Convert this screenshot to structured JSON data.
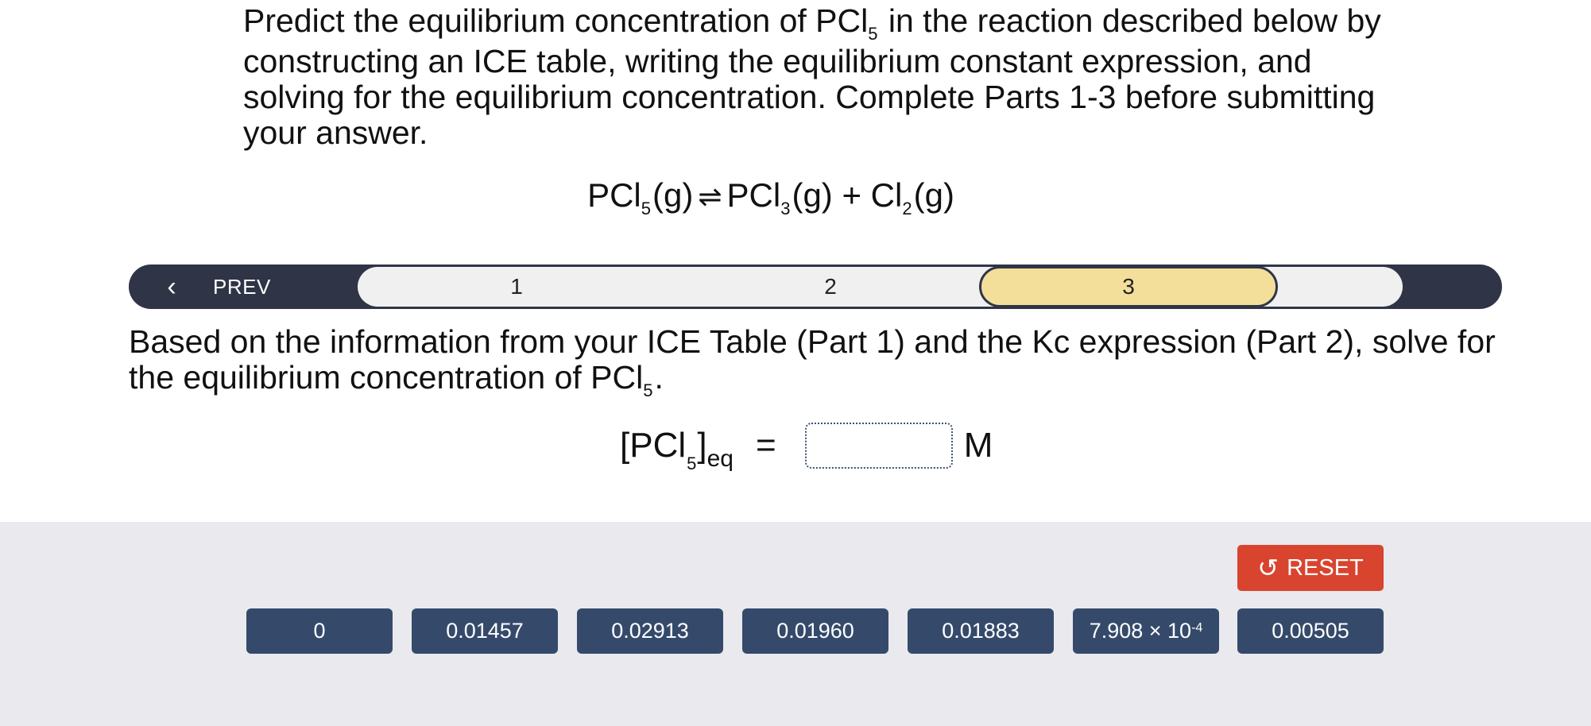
{
  "prompt": {
    "text_before": "Predict the equilibrium concentration of PCl",
    "subscript": "5",
    "text_after": " in the reaction described below by constructing an ICE table, writing the equilibrium constant expression, and solving for the equilibrium concentration. Complete Parts 1-3 before submitting your answer."
  },
  "equation": {
    "reactant": "PCl",
    "reactant_sub": "5",
    "reactant_state": "(g)",
    "arrow": "⇌",
    "product1": "PCl",
    "product1_sub": "3",
    "product1_state": "(g)",
    "plus": "+",
    "product2": "Cl",
    "product2_sub": "2",
    "product2_state": "(g)"
  },
  "nav": {
    "prev_label": "PREV",
    "prev_icon": "chevron-left-icon",
    "parts": [
      "1",
      "2",
      "3"
    ],
    "active_part": "3"
  },
  "question": {
    "text_before": "Based on the information from your ICE Table (Part 1) and the  Kc expression (Part 2), solve for the equilibrium concentration of PCl",
    "subscript": "5",
    "text_after": "."
  },
  "answer": {
    "label_open": "[PCl",
    "label_sub": "5",
    "label_close": "]",
    "label_eq": "eq",
    "equals": "=",
    "value": "",
    "unit": "M"
  },
  "tray": {
    "reset_label": "RESET",
    "reset_icon": "undo-icon",
    "chips": [
      "0",
      "0.01457",
      "0.02913",
      "0.01960",
      "0.01883",
      "7.908 × 10",
      "0.00505"
    ],
    "chip6_exponent": "-4"
  },
  "colors": {
    "nav_dark": "#2f3546",
    "active_part": "#f3df9a",
    "reset": "#d9442f",
    "chip": "#354a6b",
    "tray": "#e9e9ee"
  }
}
